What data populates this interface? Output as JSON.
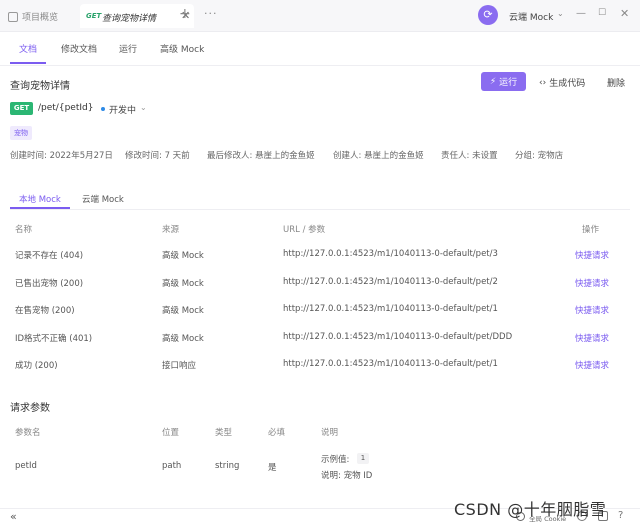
{
  "topbar": {
    "tab1_label": "项目概览",
    "tab2_method": "GET",
    "tab2_label": "查询宠物详情",
    "tab2_close": "✕",
    "add": "+",
    "more": "···",
    "env_label": "云端 Mock",
    "env_dropdown": "⌄",
    "win_min": "—",
    "win_max": "☐",
    "win_close": "✕"
  },
  "subtabs": [
    "文档",
    "修改文档",
    "运行",
    "高级 Mock"
  ],
  "api": {
    "title": "查询宠物详情",
    "run_label": "运行",
    "gen_label": "生成代码",
    "delete_label": "删除",
    "method": "GET",
    "path": "/pet/{petId}",
    "status": "开发中",
    "tag": "宠物",
    "meta": [
      "创建时间: 2022年5月27日",
      "修改时间: 7 天前",
      "最后修改人: 悬崖上的金鱼姬",
      "创建人: 悬崖上的金鱼姬",
      "责任人: 未设置",
      "分组: 宠物店"
    ]
  },
  "mock": {
    "tabs": [
      "本地 Mock",
      "云端 Mock"
    ],
    "headers": [
      "名称",
      "来源",
      "URL / 参数",
      "操作"
    ],
    "rows": [
      {
        "name": "记录不存在 (404)",
        "source": "高级 Mock",
        "url": "http://127.0.0.1:4523/m1/1040113-0-default/pet/3",
        "action": "快捷请求"
      },
      {
        "name": "已售出宠物 (200)",
        "source": "高级 Mock",
        "url": "http://127.0.0.1:4523/m1/1040113-0-default/pet/2",
        "action": "快捷请求"
      },
      {
        "name": "在售宠物 (200)",
        "source": "高级 Mock",
        "url": "http://127.0.0.1:4523/m1/1040113-0-default/pet/1",
        "action": "快捷请求"
      },
      {
        "name": "ID格式不正确 (401)",
        "source": "高级 Mock",
        "url": "http://127.0.0.1:4523/m1/1040113-0-default/pet/DDD",
        "action": "快捷请求"
      },
      {
        "name": "成功 (200)",
        "source": "接口响应",
        "url": "http://127.0.0.1:4523/m1/1040113-0-default/pet/1",
        "action": "快捷请求"
      }
    ]
  },
  "params": {
    "section_title": "请求参数",
    "headers": [
      "参数名",
      "位置",
      "类型",
      "必填",
      "说明"
    ],
    "row": {
      "name": "petId",
      "position": "path",
      "type": "string",
      "required": "是",
      "example_label": "示例值:",
      "example_value": "1",
      "desc": "说明:  宠物 ID"
    }
  },
  "bottombar": {
    "collapse": "«",
    "cookie": "全局 Cookie"
  },
  "watermark": "CSDN @十年胭脂雪",
  "colors": {
    "accent": "#7b5cf0",
    "get": "#2bb673",
    "status_dot": "#2e8ae6"
  }
}
